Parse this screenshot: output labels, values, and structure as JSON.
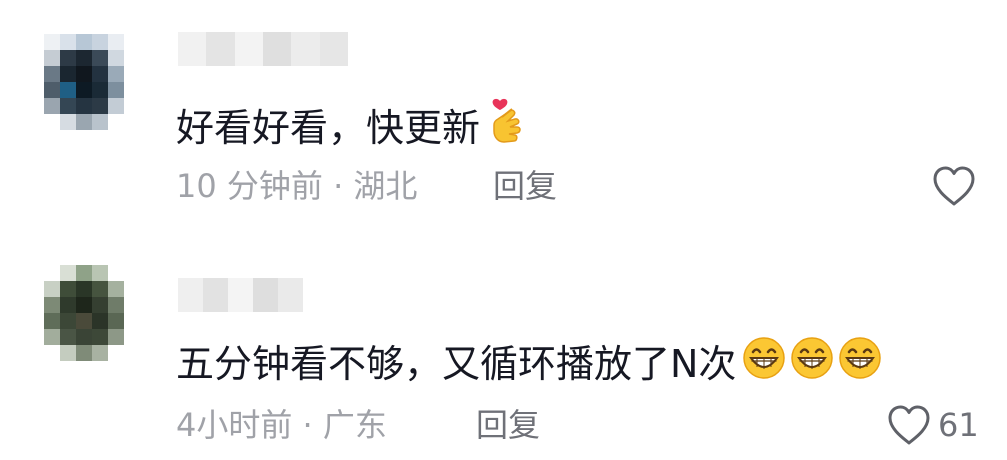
{
  "comments": [
    {
      "text": "好看好看，快更新",
      "emoji": "finger-heart",
      "time_location": "10 分钟前 · 湖北",
      "reply_label": "回复",
      "like_count": "",
      "avatar_colors": [
        [
          "#eef1f4",
          "#d9e1ea",
          "#b7c7d6",
          "#c8d3df",
          "#e9edf2",
          "#ffffff"
        ],
        [
          "#c5ccd3",
          "#2d3a46",
          "#1c2731",
          "#3b4a58",
          "#d0d8e0",
          "#ffffff"
        ],
        [
          "#6a7986",
          "#1a2630",
          "#10171e",
          "#233240",
          "#9aaab8",
          "#ffffff"
        ],
        [
          "#4e5d6a",
          "#1f5f85",
          "#0d1a24",
          "#1a2a36",
          "#7d8f9e",
          "#ffffff"
        ],
        [
          "#9aa5af",
          "#344654",
          "#253441",
          "#2c3a46",
          "#c3ccd5",
          "#ffffff"
        ],
        [
          "#ffffff",
          "#d6dce2",
          "#9aa6b0",
          "#b9c3cc",
          "#ffffff",
          "#ffffff"
        ]
      ],
      "name_colors": [
        "#f1f1f1",
        "#e4e4e4",
        "#f3f3f3",
        "#dfdfdf",
        "#ececec",
        "#e6e6e6"
      ]
    },
    {
      "text": "五分钟看不够，又循环播放了N次",
      "emoji": "grinning-face",
      "emoji_count": 3,
      "time_location": "4小时前 · 广东",
      "reply_label": "回复",
      "like_count": "61",
      "avatar_colors": [
        [
          "#ffffff",
          "#d9dfd5",
          "#8fa288",
          "#b9c5b3",
          "#ffffff",
          "#ffffff"
        ],
        [
          "#c8d0c4",
          "#3f4d39",
          "#2a3627",
          "#46543f",
          "#a5b19f",
          "#ffffff"
        ],
        [
          "#7d8a76",
          "#2f3a2c",
          "#1e261b",
          "#353f31",
          "#6f7c69",
          "#ffffff"
        ],
        [
          "#5f6d59",
          "#3c4737",
          "#4a4a3a",
          "#2b3428",
          "#5a6754",
          "#ffffff"
        ],
        [
          "#a2ad9c",
          "#4a5545",
          "#3a4436",
          "#3d4838",
          "#8d9887",
          "#ffffff"
        ],
        [
          "#ffffff",
          "#c4ccbf",
          "#7f8b78",
          "#a8b2a2",
          "#ffffff",
          "#ffffff"
        ]
      ],
      "name_colors": [
        "#efefef",
        "#e2e2e2",
        "#f4f4f4",
        "#dedede",
        "#eaeaea"
      ]
    }
  ]
}
